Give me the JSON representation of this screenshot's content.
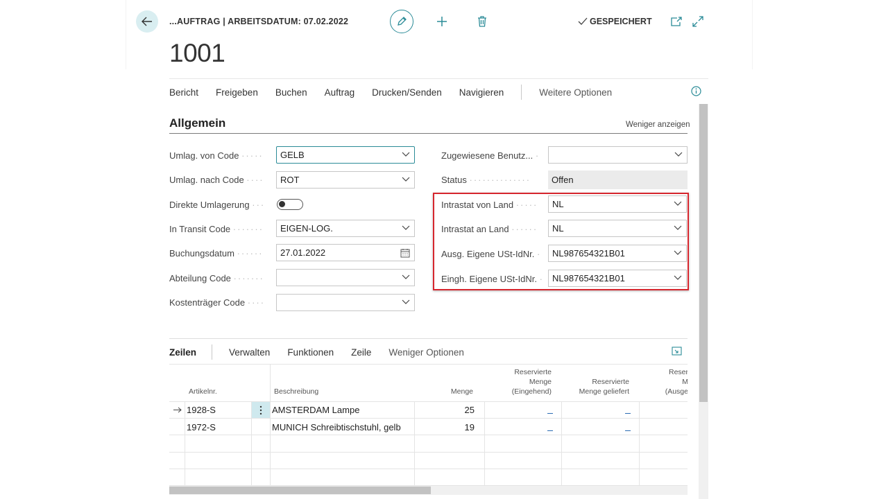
{
  "header": {
    "breadcrumb": "...AUFTRAG | ARBEITSDATUM: 07.02.2022",
    "saved_label": "GESPEICHERT",
    "page_title": "1001"
  },
  "colors": {
    "accent": "#2a8b97",
    "highlight_box": "#d6262e",
    "link": "#2a6bb3"
  },
  "icons": [
    "back-arrow-icon",
    "pencil-icon",
    "plus-icon",
    "trash-icon",
    "checkmark-icon",
    "open-new-window-icon",
    "expand-icon",
    "info-icon",
    "chevron-down-icon",
    "calendar-icon",
    "arrow-right-icon",
    "kebab-menu-icon"
  ],
  "menu": {
    "items": [
      "Bericht",
      "Freigeben",
      "Buchen",
      "Auftrag",
      "Drucken/Senden",
      "Navigieren"
    ],
    "more": "Weitere Optionen"
  },
  "section": {
    "title": "Allgemein",
    "toggle_label": "Weniger anzeigen"
  },
  "fields_left": [
    {
      "label": "Umlag. von Code",
      "value": "GELB"
    },
    {
      "label": "Umlag. nach Code",
      "value": "ROT"
    },
    {
      "label": "Direkte Umlagerung",
      "value": ""
    },
    {
      "label": "In Transit Code",
      "value": "EIGEN-LOG."
    },
    {
      "label": "Buchungsdatum",
      "value": "27.01.2022"
    },
    {
      "label": "Abteilung Code",
      "value": ""
    },
    {
      "label": "Kostenträger Code",
      "value": ""
    }
  ],
  "direct_transfer_on": false,
  "fields_right": [
    {
      "label": "Zugewiesene Benutz...",
      "value": ""
    },
    {
      "label": "Status",
      "value": "Offen"
    },
    {
      "label": "Intrastat von Land",
      "value": "NL"
    },
    {
      "label": "Intrastat an Land",
      "value": "NL"
    },
    {
      "label": "Ausg. Eigene USt-IdNr.",
      "value": "NL987654321B01"
    },
    {
      "label": "Eingh. Eigene USt-IdNr.",
      "value": "NL987654321B01"
    }
  ],
  "lines": {
    "title": "Zeilen",
    "actions": [
      "Verwalten",
      "Funktionen",
      "Zeile"
    ],
    "less": "Weniger Optionen",
    "columns": {
      "item_no": "Artikelnr.",
      "description": "Beschreibung",
      "qty": "Menge",
      "res_in": [
        "Reservierte",
        "Menge",
        "(Eingehend)"
      ],
      "res_del": [
        "Reservierte",
        "Menge geliefert"
      ],
      "res_out": [
        "Reser",
        "M",
        "(Ausge"
      ]
    },
    "rows": [
      {
        "item_no": "1928-S",
        "description": "AMSTERDAM Lampe",
        "qty": "25"
      },
      {
        "item_no": "1972-S",
        "description": "MUNICH Schreibtischstuhl, gelb",
        "qty": "19"
      }
    ]
  }
}
